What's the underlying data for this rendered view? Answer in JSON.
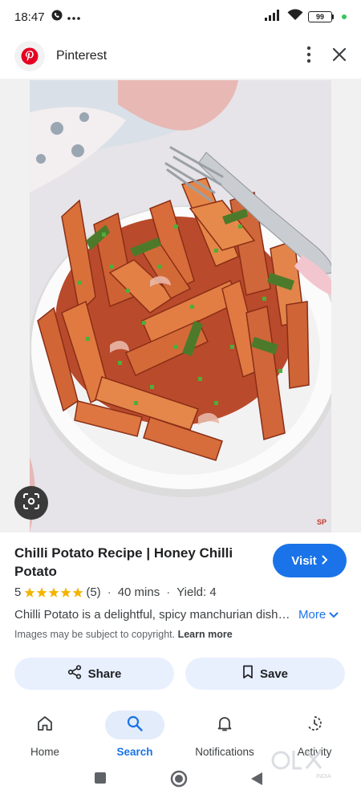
{
  "status_bar": {
    "time": "18:47",
    "battery": "99",
    "icons": [
      "call-status-icon",
      "more-dots-icon",
      "signal-icon",
      "wifi-icon",
      "battery-icon"
    ]
  },
  "header": {
    "app_name": "Pinterest",
    "logo_icon": "pinterest-logo-icon",
    "more_icon": "more-vertical-icon",
    "close_icon": "close-icon"
  },
  "image": {
    "watermark_text": "SP",
    "lens_icon": "lens-search-icon"
  },
  "result": {
    "title": "Chilli Potato Recipe | Honey Chilli Potato",
    "visit_label": "Visit",
    "rating": "5",
    "rating_stars": 5,
    "reviews": "(5)",
    "time": "40 mins",
    "yield": "Yield: 4",
    "description": "Chilli Potato is a delightful, spicy manchurian dish made with crispy fried potatoes",
    "more_label": "More",
    "copyright_text": "Images may be subject to copyright.",
    "learn_more": "Learn more",
    "share_label": "Share",
    "save_label": "Save"
  },
  "bottom_nav": {
    "items": [
      {
        "label": "Home",
        "icon": "home-icon"
      },
      {
        "label": "Search",
        "icon": "search-icon",
        "active": true
      },
      {
        "label": "Notifications",
        "icon": "bell-icon"
      },
      {
        "label": "Activity",
        "icon": "activity-icon"
      }
    ]
  },
  "watermark": {
    "text": "OLX",
    "sub": "INDIA"
  },
  "colors": {
    "accent": "#1a73e8",
    "tonal_button": "#e8f0fe",
    "star": "#f4b400",
    "pinterest_red": "#e60023"
  }
}
